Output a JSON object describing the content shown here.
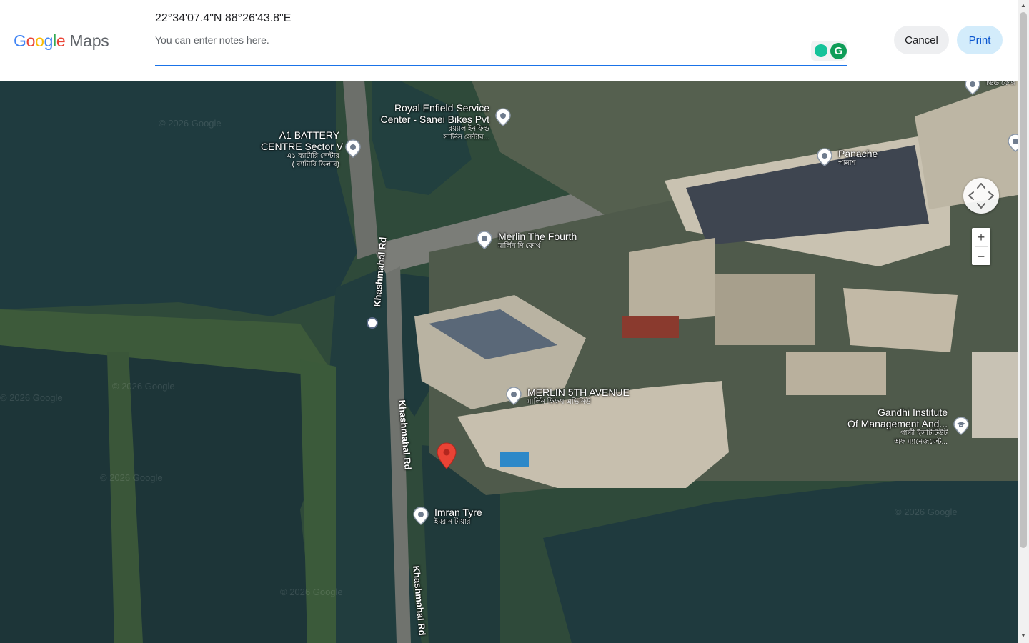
{
  "header": {
    "logo_google": "Google",
    "logo_maps": "Maps",
    "coordinates": "22°34'07.4\"N 88°26'43.8\"E",
    "notes_placeholder": "You can enter notes here.",
    "cancel_label": "Cancel",
    "print_label": "Print"
  },
  "map": {
    "watermark": "© 2026 Google",
    "pois": [
      {
        "title": "Royal Enfield Service\nCenter - Sanei Bikes Pvt",
        "subtitle": "রয়্যাল ইনফিল্ড\nসার্ভিস সেন্টার..."
      },
      {
        "title": "A1 BATTERY\nCENTRE Sector V",
        "subtitle": "এ১ ব্যাটারি সেন্টার\n( ব্যাটারি ডিলার)"
      },
      {
        "title": "Panache",
        "subtitle": "পানাশ"
      },
      {
        "title": "Merlin The Fourth",
        "subtitle": "মার্লিন দি ফোর্থ"
      },
      {
        "title": "MERLIN 5TH AVENUE",
        "subtitle": "মার্লিন ফিফথ এভিনিউ"
      },
      {
        "title": "Gandhi Institute\nOf Management And...",
        "subtitle": "গান্ধী ইন্সটিটিউট\nঅফ ম্যানেজমেন্ট..."
      },
      {
        "title": "Imran Tyre",
        "subtitle": "ইমরান টায়ার"
      },
      {
        "title": "",
        "subtitle": "আইডিয়াল\nভিউ ফেজ"
      }
    ],
    "roads": [
      "Khashmahal Rd",
      "Khashmahal Rd",
      "Khashmahal Rd"
    ],
    "zoom_in": "+",
    "zoom_out": "−"
  },
  "colors": {
    "primary_blue": "#1a73e8",
    "print_bg": "#d3ecfb",
    "cancel_bg": "#eeeff1",
    "pin_red": "#ea4335",
    "water": "#1f3b3f"
  },
  "icons": [
    "location-pin-icon",
    "red-marker-icon",
    "bus-stop-icon",
    "school-icon",
    "compass-icon",
    "grammarly-icon"
  ]
}
